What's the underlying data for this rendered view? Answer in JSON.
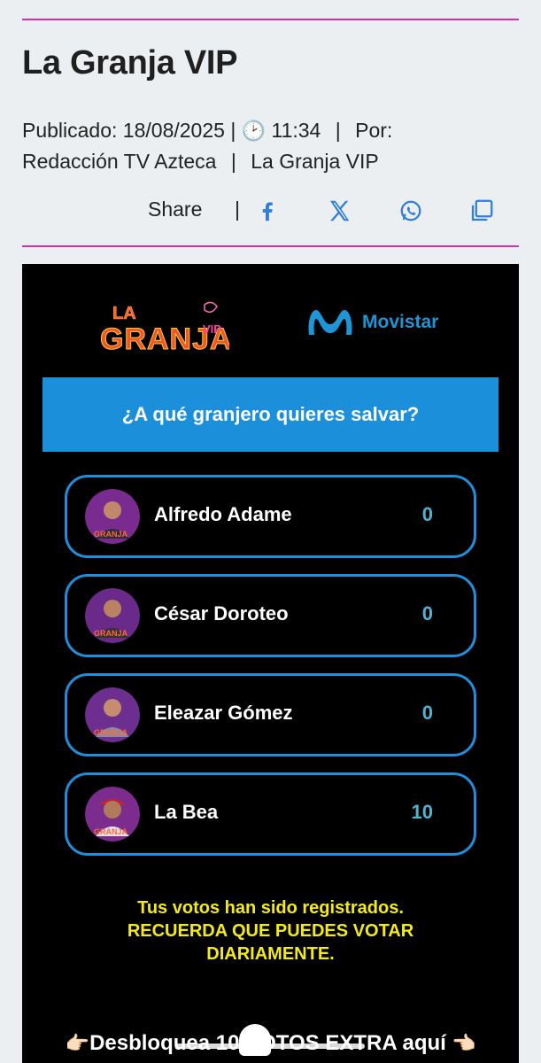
{
  "article": {
    "title": "La Granja VIP",
    "published_label": "Publicado: 18/08/2025",
    "time": "11:34",
    "by_label": "Por:",
    "author": "Redacción TV Azteca",
    "category": "La Granja VIP",
    "separator": "|"
  },
  "share": {
    "label": "Share",
    "separator": "|",
    "buttons": [
      {
        "icon": "facebook-icon"
      },
      {
        "icon": "x-icon"
      },
      {
        "icon": "whatsapp-icon"
      },
      {
        "icon": "copy-icon"
      }
    ]
  },
  "widget": {
    "logo_left": "LA GRANJA VIP",
    "logo_right": "Movistar",
    "question": "¿A qué granjero quieres salvar?",
    "options": [
      {
        "name": "Alfredo Adame",
        "votes": "0"
      },
      {
        "name": "César Doroteo",
        "votes": "0"
      },
      {
        "name": "Eleazar Gómez",
        "votes": "0"
      },
      {
        "name": "La Bea",
        "votes": "10"
      }
    ],
    "message_line1": "Tus votos han sido registrados.",
    "message_line2": "RECUERDA QUE PUEDES VOTAR",
    "message_line3": "DIARIAMENTE.",
    "unlock_text": "Desbloquea 10 VOTOS EXTRA aquí"
  },
  "colors": {
    "accent_rule": "#cf2fb0",
    "question_bg": "#1c8fdb",
    "option_border": "#1f8fdd",
    "message": "#f4ea1a",
    "vote_count": "#4fb3cf"
  }
}
